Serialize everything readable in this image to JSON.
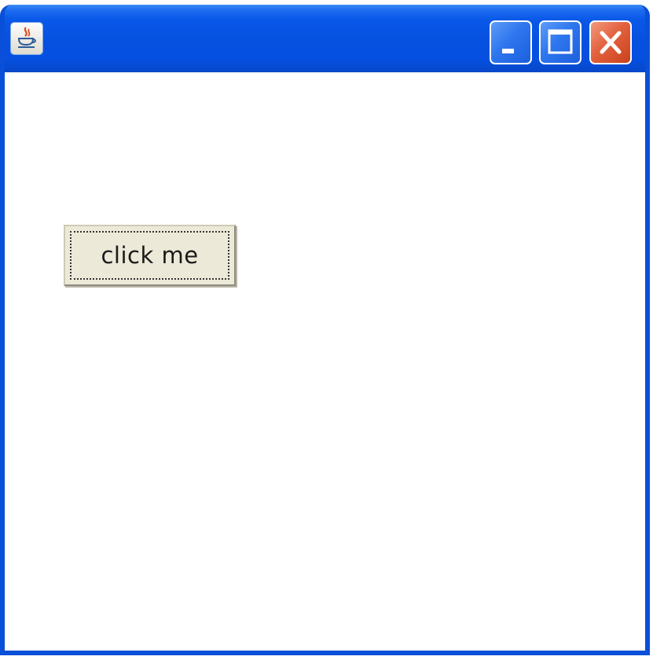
{
  "window": {
    "title": "",
    "app_icon": "java-coffee-cup-icon",
    "controls": {
      "minimize_icon": "minimize-icon",
      "maximize_icon": "maximize-icon",
      "close_icon": "close-icon"
    }
  },
  "content": {
    "button_label": "click me"
  },
  "colors": {
    "titlebar": "#0651e0",
    "frame": "#0a4fd8",
    "close_button": "#e4613e",
    "button_face": "#ece9d8"
  }
}
